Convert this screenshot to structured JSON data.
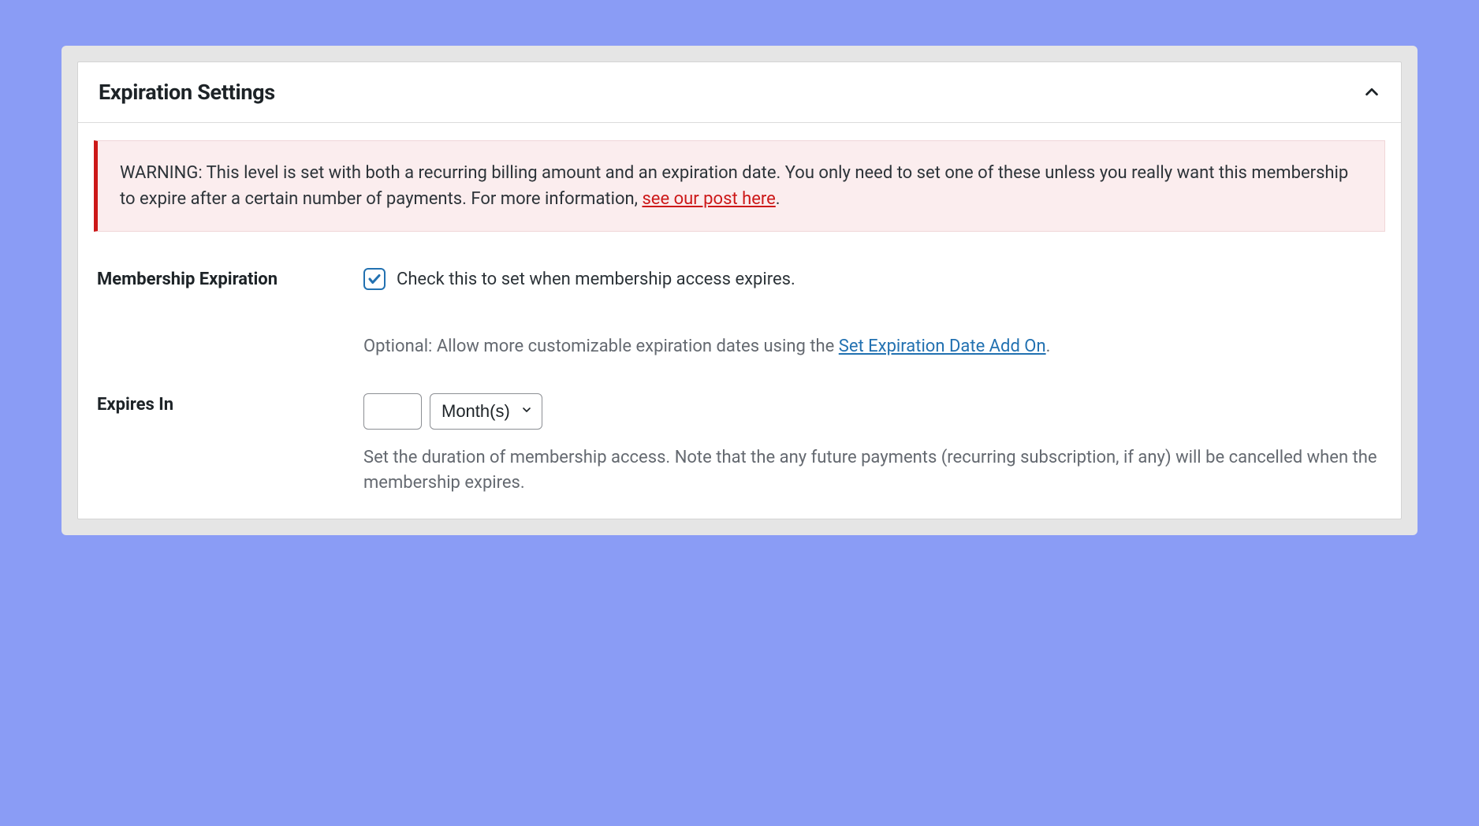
{
  "panel": {
    "title": "Expiration Settings"
  },
  "warning": {
    "text_prefix": "WARNING: This level is set with both a recurring billing amount and an expiration date. You only need to set one of these unless you really want this membership to expire after a certain number of payments. For more information, ",
    "link_text": "see our post here",
    "text_suffix": "."
  },
  "membership_expiration": {
    "label": "Membership Expiration",
    "checkbox_label": "Check this to set when membership access expires.",
    "checked": true,
    "helper_prefix": "Optional: Allow more customizable expiration dates using the ",
    "helper_link": "Set Expiration Date Add On",
    "helper_suffix": "."
  },
  "expires_in": {
    "label": "Expires In",
    "number_value": "",
    "period_selected": "Month(s)",
    "helper": "Set the duration of membership access. Note that the any future payments (recurring subscription, if any) will be cancelled when the membership expires."
  }
}
